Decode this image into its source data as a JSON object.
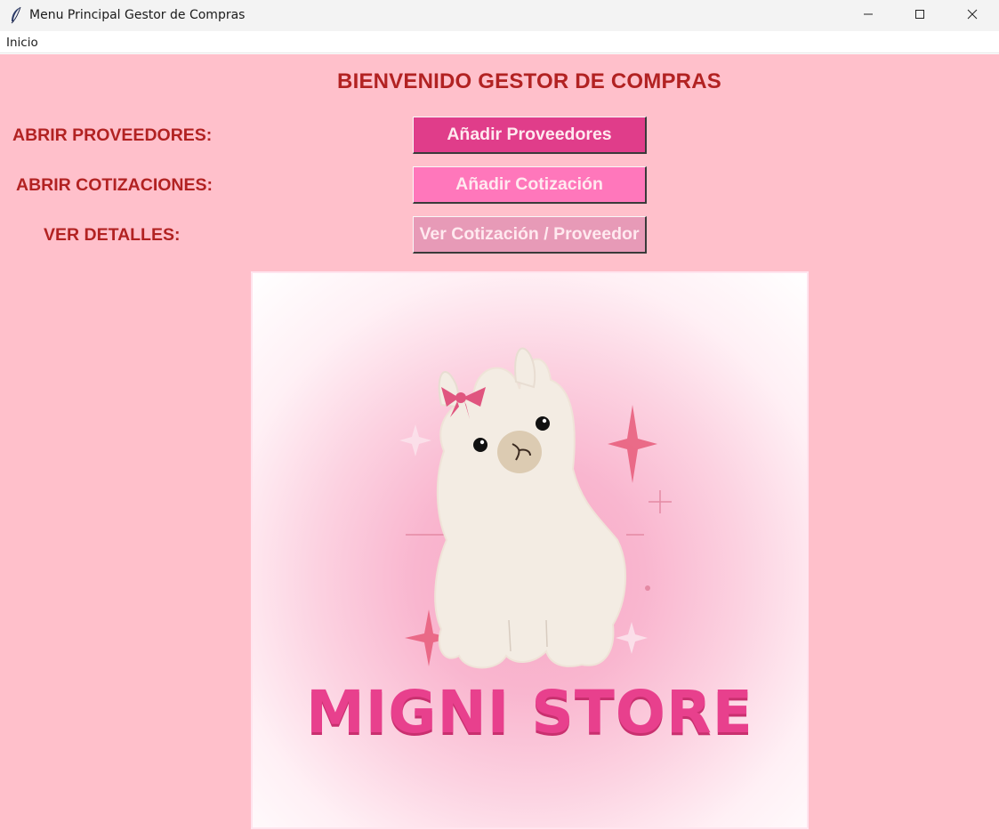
{
  "window": {
    "title": "Menu Principal Gestor de Compras",
    "app_icon": "feather-icon",
    "controls": [
      "minimize-icon",
      "maximize-icon",
      "close-icon"
    ]
  },
  "menubar": {
    "items": [
      {
        "label": "Inicio"
      }
    ]
  },
  "main": {
    "heading": "BIENVENIDO GESTOR DE COMPRAS",
    "background": "#ffc0cb",
    "text_color": "#b22222",
    "rows": [
      {
        "label": "ABRIR PROVEEDORES:",
        "button": "Añadir Proveedores",
        "button_color": "#e03d8a"
      },
      {
        "label": "ABRIR COTIZACIONES:",
        "button": "Añadir Cotización",
        "button_color": "#ff77bb"
      },
      {
        "label": "VER DETALLES:",
        "button": "Ver Cotización / Proveedor",
        "button_color": "#e79ab7"
      }
    ],
    "logo": {
      "text": "MIGNI STORE",
      "mascot": "alpaca-icon",
      "text_color": "#e8408d"
    }
  }
}
